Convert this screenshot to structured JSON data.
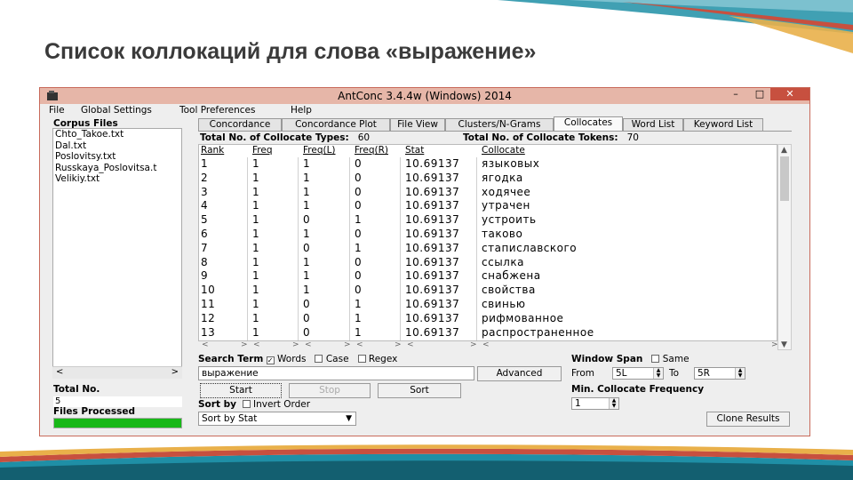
{
  "slide": {
    "title": "Список коллокаций для слова «выражение»"
  },
  "window": {
    "title": "AntConc 3.4.4w (Windows) 2014",
    "controls": {
      "minimize": "–",
      "maximize": "□",
      "close": "✕"
    }
  },
  "menu": [
    "File",
    "Global Settings",
    "Tool Preferences",
    "Help"
  ],
  "corpus": {
    "label": "Corpus Files",
    "files": [
      "Chto_Takoe.txt",
      "Dal.txt",
      "Poslovitsy.txt",
      "Russkaya_Poslovitsa.t",
      "Velikiy.txt"
    ],
    "total_label": "Total No.",
    "total_value": "5",
    "processed_label": "Files Processed",
    "processed_fraction": 1.0
  },
  "tabs": {
    "items": [
      "Concordance",
      "Concordance Plot",
      "File View",
      "Clusters/N-Grams",
      "Collocates",
      "Word List",
      "Keyword List"
    ],
    "active": "Collocates"
  },
  "summary": {
    "types_label": "Total No. of Collocate Types:",
    "types_value": "60",
    "tokens_label": "Total No. of Collocate Tokens:",
    "tokens_value": "70"
  },
  "table": {
    "headers": [
      "Rank",
      "Freq",
      "Freq(L)",
      "Freq(R)",
      "Stat",
      "Collocate"
    ],
    "rows": [
      [
        "1",
        "1",
        "1",
        "0",
        "10.69137",
        "языковых"
      ],
      [
        "2",
        "1",
        "1",
        "0",
        "10.69137",
        "ягодка"
      ],
      [
        "3",
        "1",
        "1",
        "0",
        "10.69137",
        "ходячее"
      ],
      [
        "4",
        "1",
        "1",
        "0",
        "10.69137",
        "утрачен"
      ],
      [
        "5",
        "1",
        "0",
        "1",
        "10.69137",
        "устроить"
      ],
      [
        "6",
        "1",
        "1",
        "0",
        "10.69137",
        "таково"
      ],
      [
        "7",
        "1",
        "0",
        "1",
        "10.69137",
        "стапиславского"
      ],
      [
        "8",
        "1",
        "1",
        "0",
        "10.69137",
        "ссылка"
      ],
      [
        "9",
        "1",
        "1",
        "0",
        "10.69137",
        "снабжена"
      ],
      [
        "10",
        "1",
        "1",
        "0",
        "10.69137",
        "свойства"
      ],
      [
        "11",
        "1",
        "0",
        "1",
        "10.69137",
        "свинью"
      ],
      [
        "12",
        "1",
        "0",
        "1",
        "10.69137",
        "рифмованное"
      ],
      [
        "13",
        "1",
        "0",
        "1",
        "10.69137",
        "распространенное"
      ]
    ]
  },
  "search": {
    "label": "Search Term",
    "words_label": "Words",
    "words_checked": true,
    "case_label": "Case",
    "regex_label": "Regex",
    "value": "выражение",
    "advanced": "Advanced",
    "start": "Start",
    "stop": "Stop",
    "sort": "Sort"
  },
  "sort": {
    "label": "Sort by",
    "invert_label": "Invert Order",
    "value": "Sort by Stat"
  },
  "span": {
    "label": "Window Span",
    "same_label": "Same",
    "from_label": "From",
    "from_value": "5L",
    "to_label": "To",
    "to_value": "5R",
    "min_freq_label": "Min. Collocate Frequency",
    "min_freq_value": "1",
    "clone": "Clone Results"
  },
  "colors": {
    "accent_teal": "#1f8fa6",
    "accent_red": "#c7503f",
    "progress_green": "#18b818"
  }
}
